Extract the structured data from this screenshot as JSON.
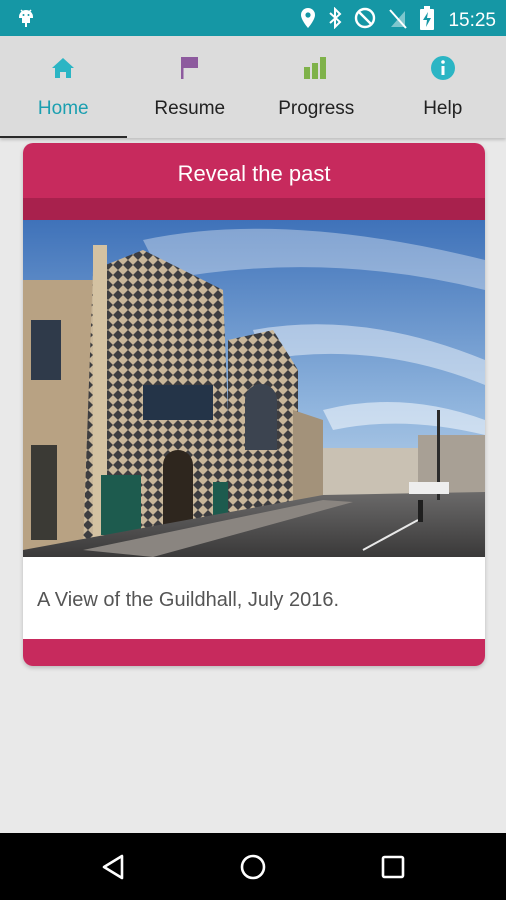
{
  "status_bar": {
    "time": "15:25",
    "color": "#1597a5",
    "icons": [
      "android-icon",
      "location-icon",
      "bluetooth-icon",
      "do-not-disturb-icon",
      "no-signal-icon",
      "battery-charging-icon"
    ]
  },
  "tabs": [
    {
      "label": "Home",
      "icon": "home-icon",
      "active": true
    },
    {
      "label": "Resume",
      "icon": "flag-icon",
      "active": false
    },
    {
      "label": "Progress",
      "icon": "bar-chart-icon",
      "active": false
    },
    {
      "label": "Help",
      "icon": "info-icon",
      "active": false
    }
  ],
  "card": {
    "title": "Reveal the past",
    "caption": "A View of the Guildhall, July 2016.",
    "accent_color": "#c72a5d"
  },
  "nav": {
    "icons": [
      "back-icon",
      "home-circle-icon",
      "recents-icon"
    ]
  }
}
